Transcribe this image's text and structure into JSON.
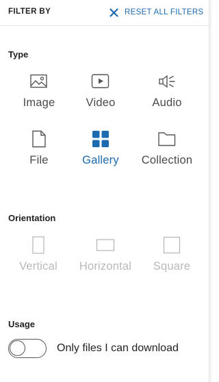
{
  "header": {
    "title": "FILTER BY",
    "reset_label": "RESET ALL FILTERS",
    "reset_icon": "close-icon"
  },
  "colors": {
    "accent": "#1c6bb0",
    "icon": "#555555",
    "disabled": "#b9b9b9"
  },
  "type_section": {
    "title": "Type",
    "options": [
      {
        "label": "Image",
        "icon": "image-icon",
        "selected": false
      },
      {
        "label": "Video",
        "icon": "video-icon",
        "selected": false
      },
      {
        "label": "Audio",
        "icon": "audio-icon",
        "selected": false
      },
      {
        "label": "File",
        "icon": "file-icon",
        "selected": false
      },
      {
        "label": "Gallery",
        "icon": "gallery-icon",
        "selected": true
      },
      {
        "label": "Collection",
        "icon": "folder-icon",
        "selected": false
      }
    ]
  },
  "orientation_section": {
    "title": "Orientation",
    "options": [
      {
        "label": "Vertical",
        "icon": "vertical-rect-icon",
        "disabled": true
      },
      {
        "label": "Horizontal",
        "icon": "horizontal-rect-icon",
        "disabled": true
      },
      {
        "label": "Square",
        "icon": "square-icon",
        "disabled": true
      }
    ]
  },
  "usage_section": {
    "title": "Usage",
    "toggle_label": "Only files I can download",
    "toggle_on": false
  }
}
